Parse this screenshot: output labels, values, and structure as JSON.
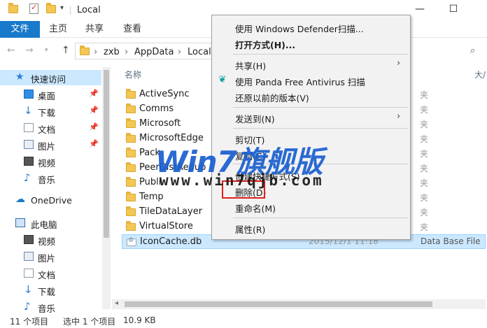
{
  "window": {
    "title": "Local",
    "minimize": "—",
    "maximize": "☐"
  },
  "ribbon": {
    "tabs": [
      "文件",
      "主页",
      "共享",
      "查看"
    ]
  },
  "nav": {
    "back": "←",
    "forward": "→",
    "up": "↑",
    "breadcrumb": [
      "zxb",
      "AppData",
      "Local"
    ]
  },
  "sidebar": {
    "items": [
      {
        "label": "快速访问",
        "icon": "star-icon",
        "pinned": false
      },
      {
        "label": "桌面",
        "icon": "desktop-icon",
        "pinned": true
      },
      {
        "label": "下载",
        "icon": "download-icon",
        "pinned": true
      },
      {
        "label": "文档",
        "icon": "document-icon",
        "pinned": true
      },
      {
        "label": "图片",
        "icon": "picture-icon",
        "pinned": true
      },
      {
        "label": "视频",
        "icon": "video-icon",
        "pinned": false
      },
      {
        "label": "音乐",
        "icon": "music-icon",
        "pinned": false
      },
      {
        "label": "OneDrive",
        "icon": "cloud-icon",
        "pinned": false
      },
      {
        "label": "此电脑",
        "icon": "computer-icon",
        "pinned": false
      },
      {
        "label": "视频",
        "icon": "video-icon",
        "pinned": false
      },
      {
        "label": "图片",
        "icon": "picture-icon",
        "pinned": false
      },
      {
        "label": "文档",
        "icon": "document-icon",
        "pinned": false
      },
      {
        "label": "下载",
        "icon": "download-icon",
        "pinned": false
      },
      {
        "label": "音乐",
        "icon": "music-icon",
        "pinned": false
      }
    ]
  },
  "columns": {
    "name": "名称",
    "size": "大/"
  },
  "files": [
    {
      "name": "ActiveSync",
      "type": "夹"
    },
    {
      "name": "Comms",
      "type": "夹"
    },
    {
      "name": "Microsoft",
      "type": "夹"
    },
    {
      "name": "MicrosoftEdge",
      "type": "夹"
    },
    {
      "name": "Pack",
      "type": "夹"
    },
    {
      "name": "PeerDistRepub",
      "type": "夹"
    },
    {
      "name": "Publi",
      "type": "夹"
    },
    {
      "name": "Temp",
      "type": "夹"
    },
    {
      "name": "TileDataLayer",
      "type": "夹"
    },
    {
      "name": "VirtualStore",
      "type": "夹"
    },
    {
      "name": "IconCache.db",
      "date": "2015/12/1 11:18",
      "type": "Data Base File"
    }
  ],
  "status": {
    "count": "11 个项目",
    "selected": "选中 1 个项目",
    "size": "10.9 KB"
  },
  "context_menu": {
    "scan_defender": "使用 Windows Defender扫描...",
    "open_with": "打开方式(H)...",
    "share": "共享(H)",
    "scan_panda": "使用 Panda Free Antivirus 扫描",
    "restore": "还原以前的版本(V)",
    "send_to": "发送到(N)",
    "cut": "剪切(T)",
    "copy": "复制(C)",
    "create_shortcut": "创建快捷方式(S)",
    "delete": "删除(D)",
    "rename": "重命名(M)",
    "properties": "属性(R)",
    "submenu_arrow": "›"
  },
  "watermark": {
    "line1": "Win7旗舰版",
    "line2": "www.win7qjb.com"
  },
  "colors": {
    "accent": "#1979ca",
    "selection": "#cce8ff",
    "highlight_box": "#e02020",
    "watermark_blue": "#1a5fd0"
  }
}
